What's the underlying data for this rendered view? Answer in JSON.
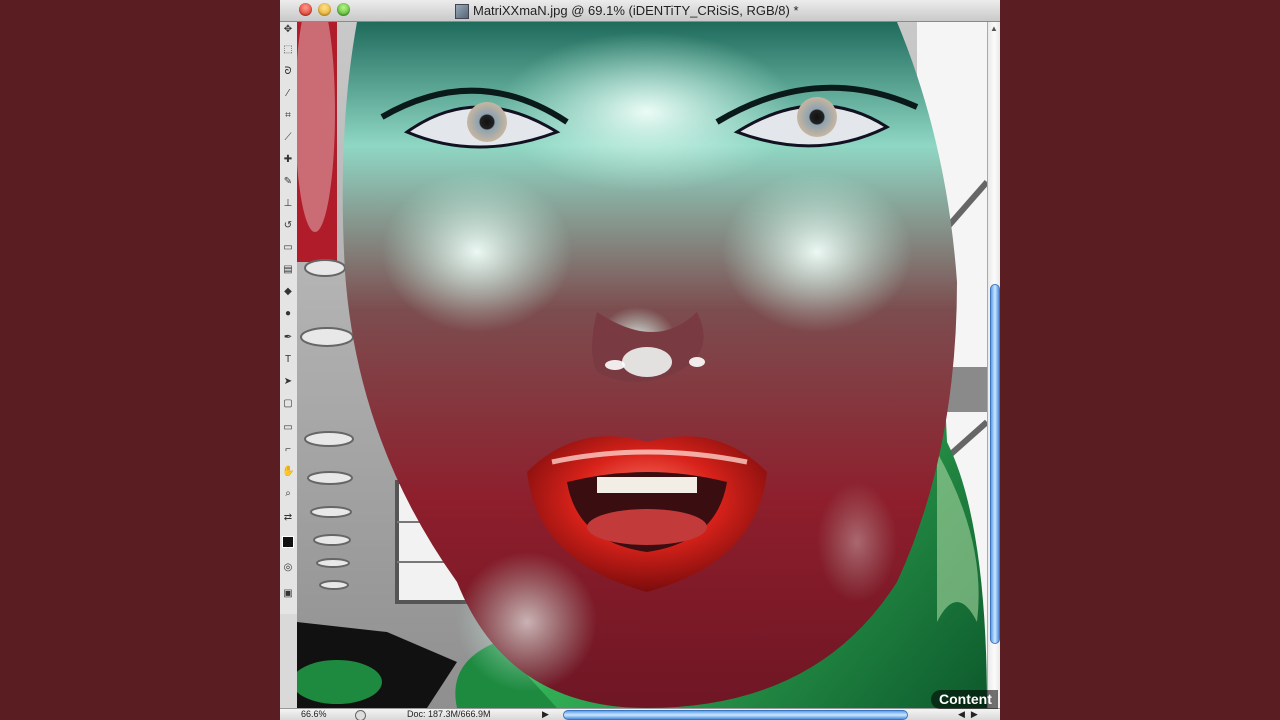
{
  "window": {
    "title": "MatriXXmaN.jpg @ 69.1% (iDENTiTY_CRiSiS, RGB/8) *"
  },
  "toolbar": {
    "tools": [
      "move-tool",
      "marquee-tool",
      "lasso-tool",
      "magic-wand-tool",
      "crop-tool",
      "slice-tool",
      "healing-tool",
      "brush-tool",
      "clone-stamp-tool",
      "history-brush-tool",
      "eraser-tool",
      "gradient-tool",
      "blur-tool",
      "dodge-tool",
      "pen-tool",
      "type-tool",
      "path-selection-tool",
      "shape-tool",
      "notes-tool",
      "eyedropper-tool",
      "hand-tool",
      "zoom-tool",
      "foreground-color",
      "background-color",
      "quick-mask",
      "screen-mode"
    ]
  },
  "statusbar": {
    "zoom": "66.6%",
    "doc_size": "Doc: 187.3M/666.9M"
  },
  "overlay": {
    "watermark": "Content"
  },
  "colors": {
    "background": "#5a1e22",
    "skin_highlight": "#bff3e2",
    "lips": "#d8221a",
    "green_cloth": "#2fa04e"
  }
}
